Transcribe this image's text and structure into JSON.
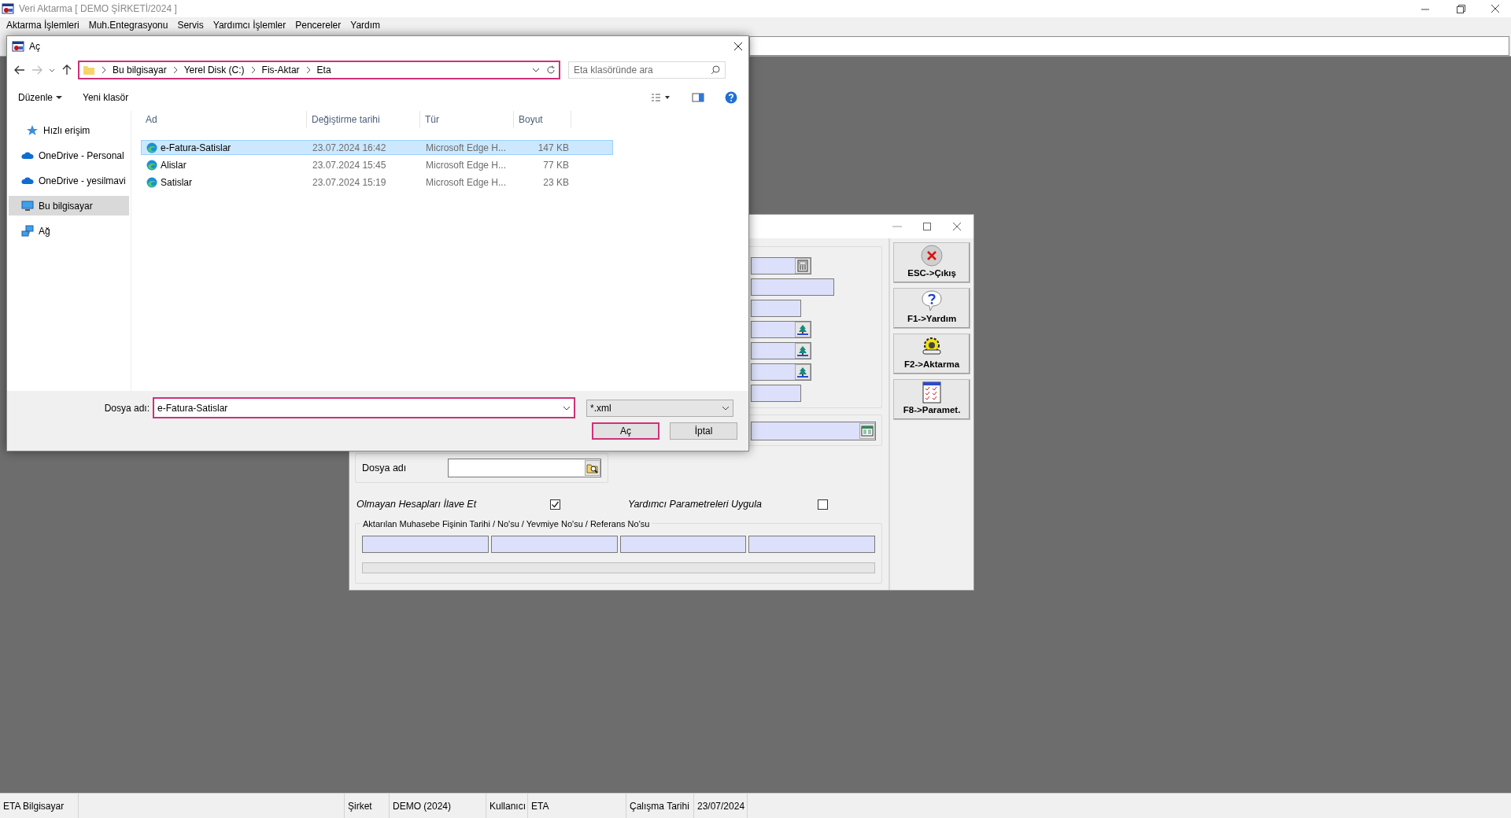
{
  "window": {
    "title": "Veri Aktarma [ DEMO ŞİRKETİ/2024 ]"
  },
  "menu": [
    "Aktarma İşlemleri",
    "Muh.Entegrasyonu",
    "Servis",
    "Yardımcı İşlemler",
    "Pencereler",
    "Yardım"
  ],
  "dialog": {
    "title": "Aç",
    "address": {
      "segments": [
        "Bu bilgisayar",
        "Yerel Disk (C:)",
        "Fis-Aktar",
        "Eta"
      ],
      "highlighted": true
    },
    "search": {
      "placeholder": "Eta klasöründe ara"
    },
    "commands": [
      "Düzenle",
      "Yeni klasör"
    ],
    "sidebar": [
      {
        "label": "Hızlı erişim",
        "selected": false
      },
      {
        "label": "OneDrive - Personal",
        "selected": false
      },
      {
        "label": "OneDrive - yesilmavi",
        "selected": false
      },
      {
        "label": "Bu bilgisayar",
        "selected": true
      },
      {
        "label": "Ağ",
        "selected": false
      }
    ],
    "columns": [
      "Ad",
      "Değiştirme tarihi",
      "Tür",
      "Boyut"
    ],
    "files": [
      {
        "name": "e-Fatura-Satislar",
        "date": "23.07.2024 16:42",
        "type": "Microsoft Edge H...",
        "size": "147 KB",
        "selected": true
      },
      {
        "name": "Alislar",
        "date": "23.07.2024 15:45",
        "type": "Microsoft Edge H...",
        "size": "77 KB",
        "selected": false
      },
      {
        "name": "Satislar",
        "date": "23.07.2024 15:19",
        "type": "Microsoft Edge H...",
        "size": "23 KB",
        "selected": false
      }
    ],
    "filename": {
      "label": "Dosya adı:",
      "value": "e-Fatura-Satislar",
      "highlighted": true
    },
    "filter": {
      "value": "*.xml"
    },
    "buttons": [
      {
        "label": "Aç",
        "highlighted": true
      },
      {
        "label": "İptal",
        "highlighted": false
      }
    ]
  },
  "form": {
    "file_label": "Dosya adı",
    "progress": {
      "level": 0
    },
    "options": [
      {
        "label": "Olmayan Hesapları İlave Et",
        "checked": true
      },
      {
        "label": "Yardımcı Parametreleri Uygula",
        "checked": false
      }
    ],
    "group_title": "Aktarılan Muhasebe Fişinin Tarihi / No'su / Yevmiye No'su / Referans No'su",
    "side_buttons": [
      "ESC->Çıkış",
      "F1->Yardım",
      "F2->Aktarma",
      "F8->Paramet."
    ]
  },
  "status_bar": [
    "ETA Bilgisayar",
    "Şirket",
    "DEMO (2024)",
    "Kullanıcı",
    "ETA",
    "Çalışma Tarihi",
    "23/07/2024"
  ]
}
